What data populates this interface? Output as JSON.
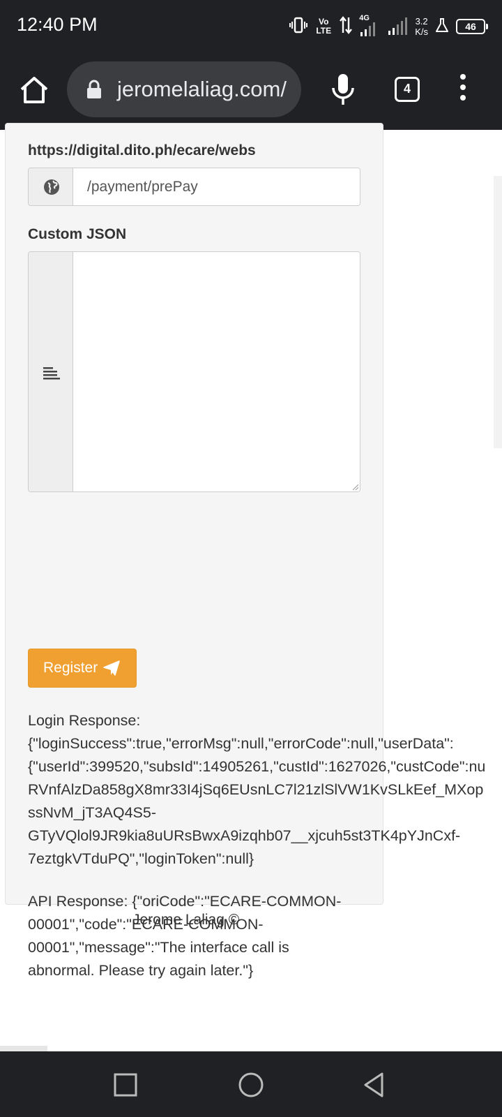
{
  "status_bar": {
    "time": "12:40 PM",
    "network_type": "4G",
    "volte": "Vo LTE",
    "net_speed_value": "3.2",
    "net_speed_unit": "K/s",
    "battery": "46",
    "icons": [
      "vibrate-icon",
      "volte-icon",
      "data-arrows-icon",
      "signal-4g-icon",
      "signal-icon",
      "lab-icon",
      "battery-icon"
    ]
  },
  "browser": {
    "url": "jeromelaliag.com/",
    "tab_count": "4",
    "icons": [
      "home-icon",
      "lock-icon",
      "mic-icon",
      "tabs-icon",
      "more-vert-icon"
    ]
  },
  "form": {
    "url_label": "https://digital.dito.ph/ecare/webs",
    "url_input_value": "/payment/prePay",
    "json_label": "Custom JSON",
    "json_value": "",
    "register_label": "Register",
    "button_color": "#f0a030"
  },
  "responses": {
    "login_lines": [
      "Login Response:",
      "{\"loginSuccess\":true,\"errorMsg\":null,\"errorCode\":null,\"userData\":",
      "{\"userId\":399520,\"subsId\":14905261,\"custId\":1627026,\"custCode\":nu",
      "RVnfAlzDa858gX8mr33I4jSq6EUsnLC7l21zlSlVW1KvSLkEef_MXop",
      "ssNvM_jT3AQ4S5-",
      "GTyVQlol9JR9kia8uURsBwxA9izqhb07__xjcuh5st3TK4pYJnCxf-",
      "7eztgkVTduPQ\",\"loginToken\":null}"
    ],
    "api_lines": [
      "API Response: {\"oriCode\":\"ECARE-COMMON-",
      "00001\",\"code\":\"ECARE-COMMON-",
      "00001\",\"message\":\"The interface call is",
      "abnormal. Please try again later.\"}"
    ]
  },
  "footer": {
    "text": "Jerome Laliag ©"
  }
}
